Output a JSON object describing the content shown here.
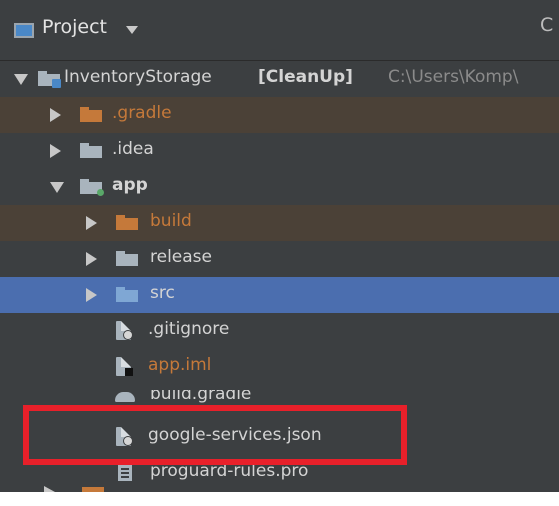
{
  "panel": {
    "title": "Project",
    "extra": "C"
  },
  "tree": {
    "root": {
      "name": "InventoryStorage",
      "tag": "[CleanUp]",
      "path": "C:\\Users\\Komp\\"
    },
    "gradle": ".gradle",
    "idea": ".idea",
    "app": "app",
    "build": "build",
    "release": "release",
    "src": "src",
    "gitignore": ".gitignore",
    "app_iml": "app.iml",
    "build_gradle": "build.gradle",
    "google_services": "google-services.json",
    "proguard": "proguard-rules.pro"
  },
  "colors": {
    "panel_bg": "#3c3f41",
    "selection": "#4b6eaf",
    "excluded_text": "#c5793a",
    "highlight_box": "#e8202a"
  },
  "icons": [
    "project-view-icon",
    "dropdown-caret-icon",
    "expand-arrow-icon",
    "collapse-arrow-icon",
    "folder-icon",
    "module-folder-icon",
    "source-folder-icon",
    "file-icon",
    "gradle-icon",
    "json-file-icon",
    "text-file-icon"
  ]
}
